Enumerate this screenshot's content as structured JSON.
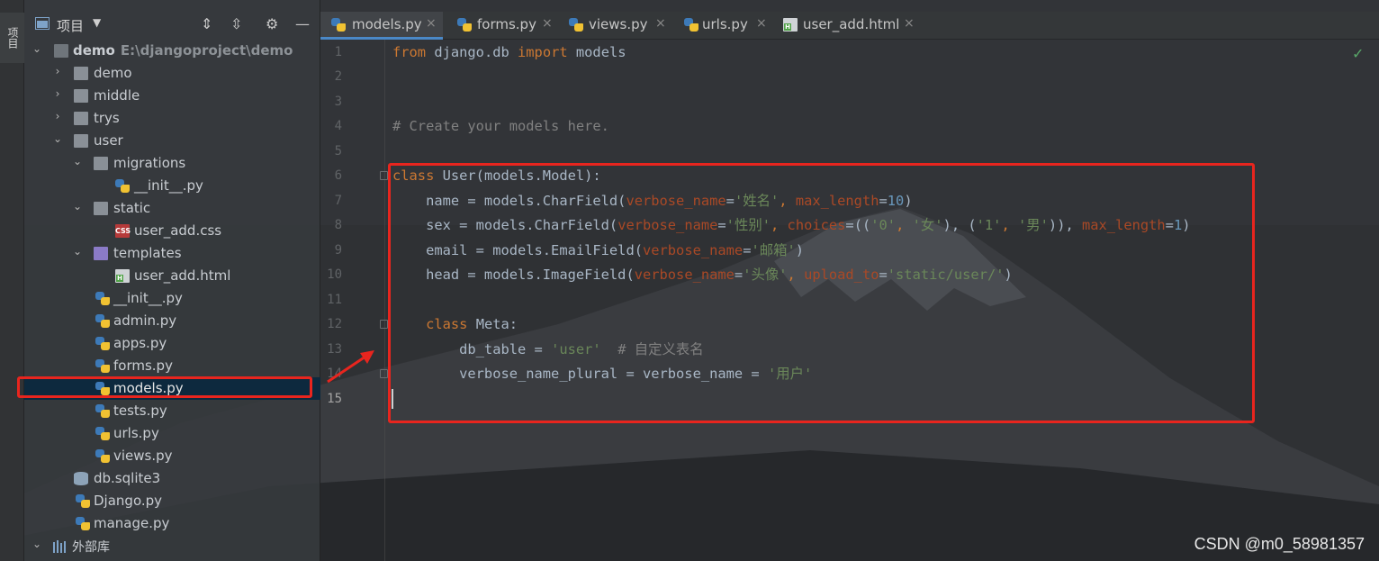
{
  "toolstrip": {
    "vertical_tab": "项目"
  },
  "project": {
    "title": "项目",
    "tree": [
      {
        "label": "demo",
        "sub": "E:\\djangoproject\\demo",
        "type": "root-folder",
        "expanded": true
      },
      {
        "label": "demo",
        "type": "package",
        "expanded": false
      },
      {
        "label": "middle",
        "type": "folder",
        "expanded": false
      },
      {
        "label": "trys",
        "type": "package",
        "expanded": false
      },
      {
        "label": "user",
        "type": "package",
        "expanded": true
      },
      {
        "label": "migrations",
        "type": "package",
        "expanded": true
      },
      {
        "label": "__init__.py",
        "type": "python"
      },
      {
        "label": "static",
        "type": "folder",
        "expanded": true
      },
      {
        "label": "user_add.css",
        "type": "css"
      },
      {
        "label": "templates",
        "type": "template-folder",
        "expanded": true
      },
      {
        "label": "user_add.html",
        "type": "html"
      },
      {
        "label": "__init__.py",
        "type": "python"
      },
      {
        "label": "admin.py",
        "type": "python"
      },
      {
        "label": "apps.py",
        "type": "python"
      },
      {
        "label": "forms.py",
        "type": "python"
      },
      {
        "label": "models.py",
        "type": "python",
        "selected": true
      },
      {
        "label": "tests.py",
        "type": "python"
      },
      {
        "label": "urls.py",
        "type": "python"
      },
      {
        "label": "views.py",
        "type": "python"
      },
      {
        "label": "db.sqlite3",
        "type": "database"
      },
      {
        "label": "Django.py",
        "type": "python"
      },
      {
        "label": "manage.py",
        "type": "python"
      },
      {
        "label": "外部库",
        "type": "libraries",
        "expanded": true
      }
    ]
  },
  "tabs": [
    {
      "label": "models.py",
      "active": true,
      "icon": "python-file-icon"
    },
    {
      "label": "forms.py",
      "active": false,
      "icon": "python-file-icon"
    },
    {
      "label": "views.py",
      "active": false,
      "icon": "python-file-icon"
    },
    {
      "label": "urls.py",
      "active": false,
      "icon": "python-file-icon"
    },
    {
      "label": "user_add.html",
      "active": false,
      "icon": "html-file-icon"
    }
  ],
  "editor": {
    "line_numbers": [
      "1",
      "2",
      "3",
      "4",
      "5",
      "6",
      "7",
      "8",
      "9",
      "10",
      "11",
      "12",
      "13",
      "14",
      "15"
    ],
    "current_line": "15",
    "lines": {
      "l1": {
        "kw1": "from",
        "t1": " django.db ",
        "kw2": "import",
        "t2": " models"
      },
      "l4": {
        "comment": "# Create your models here."
      },
      "l6": {
        "kw": "class",
        "t": " User(models.Model):"
      },
      "l7": {
        "a": "    name = models.CharField(",
        "p1": "verbose_name",
        "eq1": "=",
        "s1": "'姓名'",
        "c1": ", ",
        "p2": "max_length",
        "eq2": "=",
        "n1": "10",
        "end": ")"
      },
      "l8": {
        "a": "    sex = models.CharField(",
        "p1": "verbose_name",
        "eq1": "=",
        "s1": "'性别'",
        "c1": ", ",
        "p2": "choices",
        "eq2": "=",
        "t1": "((",
        "s2": "'0'",
        "c2": ", ",
        "s3": "'女'",
        "t2": "), (",
        "s4": "'1'",
        "c3": ", ",
        "s5": "'男'",
        "t3": ")), ",
        "p3": "max_length",
        "eq3": "=",
        "n1": "1",
        "end": ")"
      },
      "l9": {
        "a": "    email = models.EmailField(",
        "p1": "verbose_name",
        "eq1": "=",
        "s1": "'邮箱'",
        "end": ")"
      },
      "l10": {
        "a": "    head = models.ImageField(",
        "p1": "verbose_name",
        "eq1": "=",
        "s1": "'头像'",
        "c1": ", ",
        "p2": "upload_to",
        "eq2": "=",
        "s2": "'static/user/'",
        "end": ")"
      },
      "l12": {
        "indent": "    ",
        "kw": "class",
        "t": " Meta:"
      },
      "l13": {
        "a": "        db_table = ",
        "s1": "'user'",
        "cm": "  # 自定义表名"
      },
      "l14": {
        "a": "        verbose_name_plural = verbose_name = ",
        "s1": "'用户'"
      }
    }
  },
  "watermark": "CSDN @m0_58981357",
  "colors": {
    "keyword": "#cc7832",
    "string": "#6a8759",
    "number": "#6897bb",
    "comment": "#808080",
    "param": "#aa4926",
    "annotation_red": "#e8251e"
  }
}
